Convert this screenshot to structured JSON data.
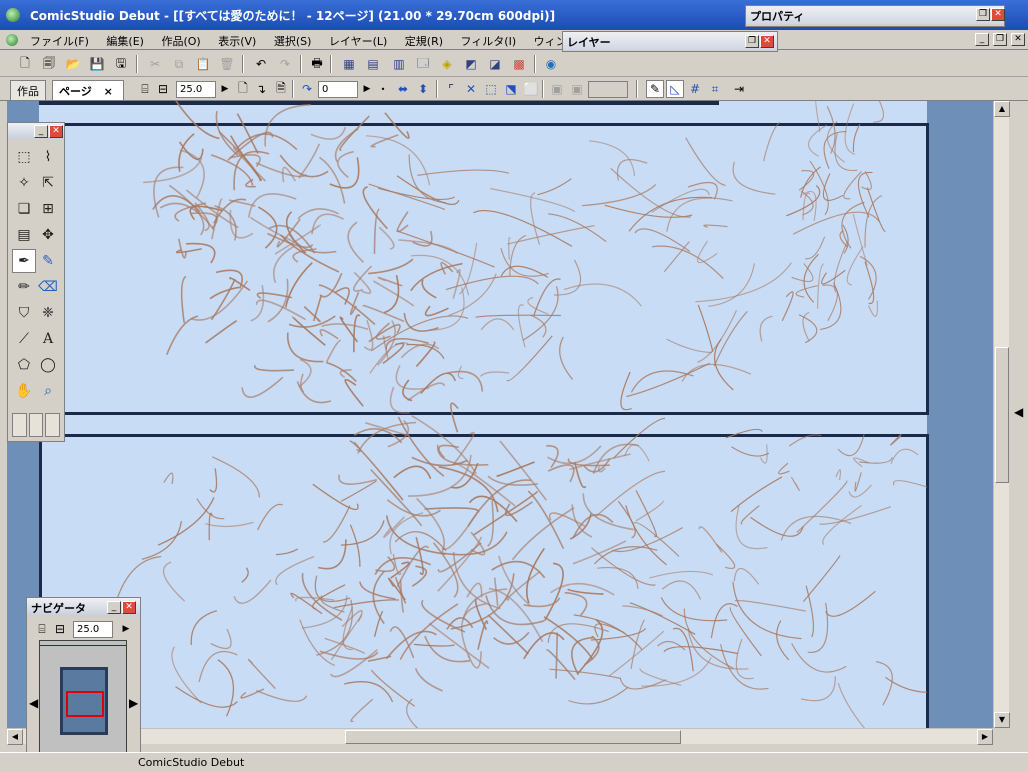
{
  "window": {
    "title": "ComicStudio Debut - [[すべては愛のために！ - 12ページ] (21.00 * 29.70cm 600dpi)]"
  },
  "menu": {
    "items": [
      "ファイル(F)",
      "編集(E)",
      "作品(O)",
      "表示(V)",
      "選択(S)",
      "レイヤー(L)",
      "定規(R)",
      "フィルタ(I)",
      "ウィンドウ(W)"
    ]
  },
  "tabs": {
    "work": "作品",
    "page": "ページ",
    "close": "×"
  },
  "toolbar2": {
    "zoom_value": "25.0",
    "rotate_value": "0"
  },
  "properties_window": {
    "title": "プロパティ"
  },
  "layer_window": {
    "title": "レイヤー"
  },
  "navigator": {
    "title": "ナビゲータ",
    "zoom_value": "25.0"
  },
  "statusbar": {
    "text": "ComicStudio Debut"
  },
  "colors": {
    "title_bar": "#1c4cb4",
    "page_bg": "#c8dcf5",
    "sketch_stroke": "#a87a62",
    "panel_border": "#1a2a48",
    "nav_frame": "#e00000"
  },
  "icons": {
    "toolbar1": [
      "new-page-icon",
      "new-work-icon",
      "open-icon",
      "save-icon",
      "save-all-icon",
      "cut-icon",
      "copy-icon",
      "paste-icon",
      "clear-icon",
      "undo-icon",
      "redo-icon",
      "print-icon",
      "layer-view-icon",
      "page-view-icon",
      "panel-icon",
      "window-icon",
      "material-icon",
      "property-icon",
      "navigator-icon",
      "color-icon",
      "render-icon"
    ],
    "tools": [
      "marquee-icon",
      "lasso-icon",
      "magic-wand-icon",
      "object-select-icon",
      "layer-select-icon",
      "layer-move-icon",
      "ruler-icon",
      "move-icon",
      "pen-icon",
      "marker-icon",
      "pencil-icon",
      "eraser-icon",
      "fill-icon",
      "airbrush-icon",
      "line-icon",
      "text-icon",
      "polygon-icon",
      "ellipse-icon",
      "hand-icon",
      "zoom-icon"
    ]
  }
}
